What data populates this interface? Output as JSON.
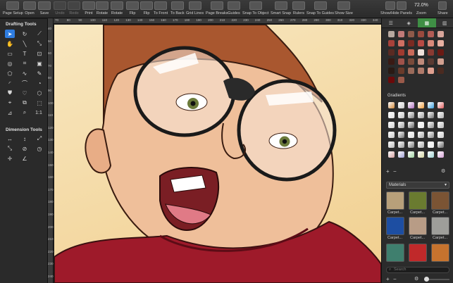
{
  "toolbar": {
    "items": [
      {
        "label": "Page Setup",
        "icon": "gear-icon"
      },
      {
        "label": "Open",
        "icon": "folder-icon"
      },
      {
        "label": "Save",
        "icon": "save-icon"
      },
      {
        "label": "Undo",
        "icon": "undo-icon",
        "disabled": true
      },
      {
        "label": "Redo",
        "icon": "redo-icon",
        "disabled": true
      },
      {
        "label": "Print",
        "icon": "print-icon"
      },
      {
        "label": "Rotate",
        "icon": "rotate-left-icon"
      },
      {
        "label": "Rotate",
        "icon": "rotate-right-icon"
      },
      {
        "label": "Flip",
        "icon": "flip-horizontal-icon"
      },
      {
        "label": "Flip",
        "icon": "flip-vertical-icon"
      },
      {
        "label": "To Front",
        "icon": "to-front-icon"
      },
      {
        "label": "To Back",
        "icon": "to-back-icon"
      },
      {
        "label": "Grid Lines",
        "icon": "grid-icon"
      },
      {
        "label": "Page Breaks",
        "icon": "page-breaks-icon"
      },
      {
        "label": "Guides",
        "icon": "guides-icon"
      },
      {
        "label": "Snap To Object",
        "icon": "snap-object-icon"
      },
      {
        "label": "Smart Snap",
        "icon": "smart-snap-icon"
      },
      {
        "label": "Rulers",
        "icon": "rulers-icon"
      },
      {
        "label": "Snap To Guides",
        "icon": "snap-guides-icon"
      },
      {
        "label": "Show Size",
        "icon": "show-size-icon"
      },
      {
        "label": "Show/Hide Panels",
        "icon": "panels-icon"
      },
      {
        "label": "Zoom",
        "value": "72.0%"
      },
      {
        "label": "Share",
        "icon": "share-icon"
      }
    ]
  },
  "drafting_tools": {
    "title": "Drafting Tools"
  },
  "dimension_tools": {
    "title": "Dimension Tools"
  },
  "scale_label": "1:1",
  "ruler_top": [
    "70",
    "80",
    "90",
    "100",
    "110",
    "120",
    "130",
    "140",
    "150",
    "160",
    "170",
    "180",
    "190",
    "200",
    "210",
    "220",
    "230",
    "240",
    "250",
    "260",
    "270",
    "280",
    "290",
    "300",
    "310",
    "320",
    "330",
    "340"
  ],
  "ruler_left": [
    "40",
    "50",
    "60",
    "70",
    "80",
    "90",
    "100",
    "110",
    "120",
    "130",
    "140",
    "150",
    "160",
    "170",
    "180",
    "190",
    "200",
    "210",
    "220",
    "230",
    "240"
  ],
  "right_panel": {
    "gradients_title": "Gradients",
    "materials_select": "Materials",
    "materials": [
      "Carpet...",
      "Carpet...",
      "Carpet...",
      "Carpet...",
      "Carpet...",
      "Carpet...",
      "",
      "",
      ""
    ],
    "search_placeholder": "Search"
  },
  "colors": {
    "accent": "#2f7de0",
    "active_tab": "#3f8f45"
  }
}
